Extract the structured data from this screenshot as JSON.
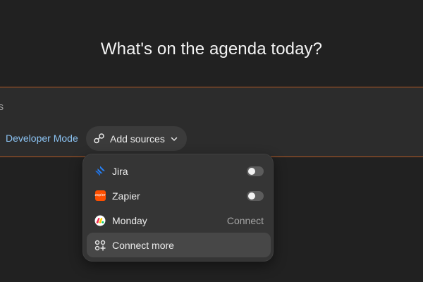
{
  "headline": "What's on the agenda today?",
  "composer": {
    "placeholder_visible": "ols",
    "developer_mode_label": "Developer Mode",
    "add_sources_label": "Add sources",
    "add_sources_icon": "connectors-icon",
    "chevron_icon": "chevron-down-icon"
  },
  "menu": {
    "items": [
      {
        "label": "Jira",
        "icon": "jira-icon",
        "control": "toggle",
        "enabled": false
      },
      {
        "label": "Zapier",
        "icon": "zapier-icon",
        "control": "toggle",
        "enabled": false
      },
      {
        "label": "Monday",
        "icon": "monday-icon",
        "control": "link",
        "action_label": "Connect"
      },
      {
        "label": "Connect more",
        "icon": "apps-plus-icon",
        "highlighted": true
      }
    ],
    "zapier_icon_text": "zapier"
  },
  "colors": {
    "background": "#212121",
    "composer": "#2c2c2c",
    "composer_border": "#b45a24",
    "menu": "#353535",
    "menu_highlight": "#474747",
    "link_blue": "#8cc4f4",
    "zapier_orange": "#ff4f00"
  }
}
